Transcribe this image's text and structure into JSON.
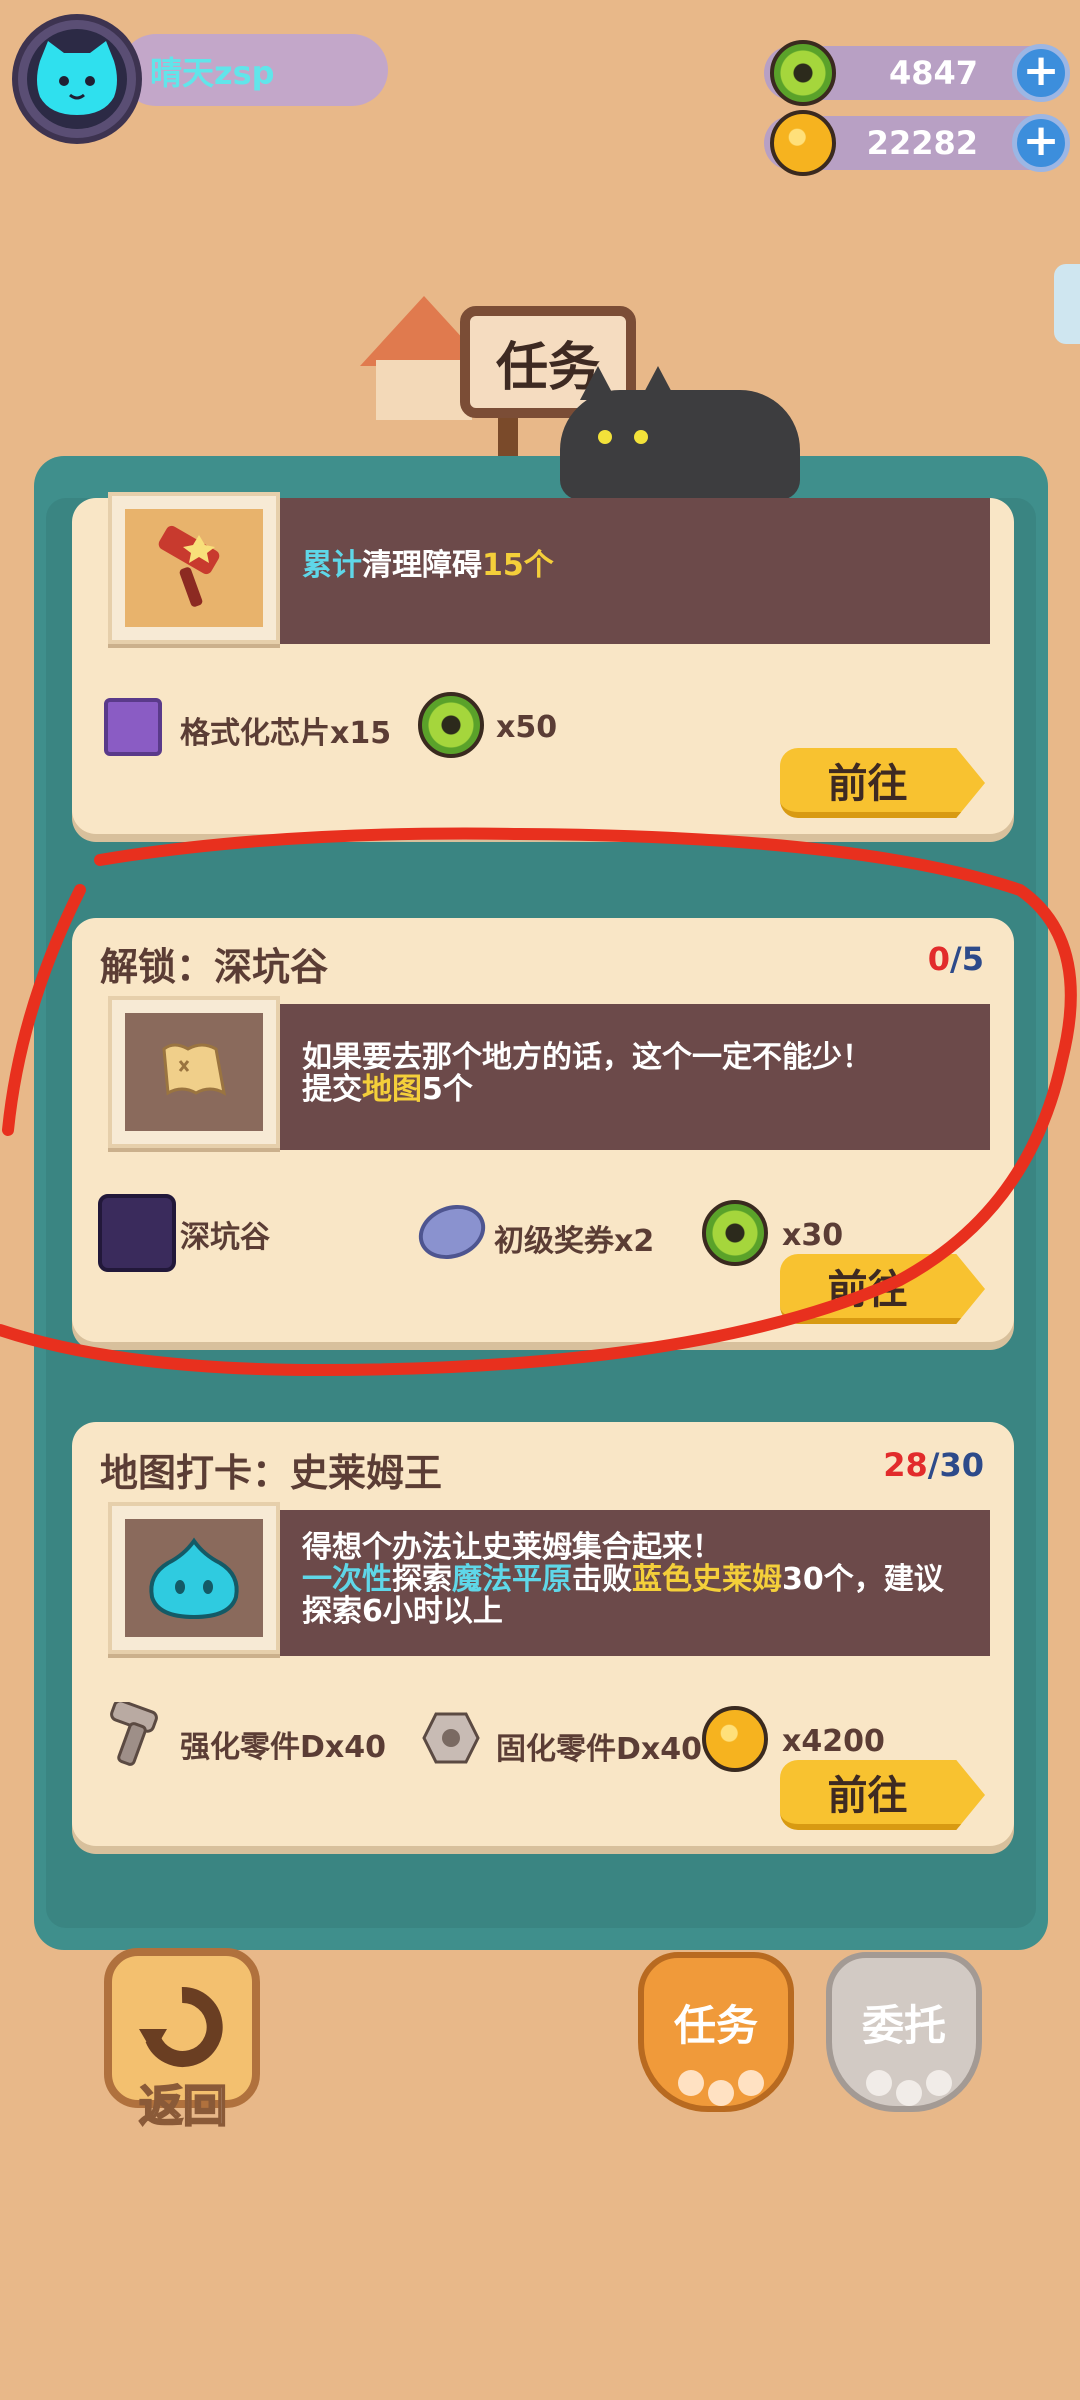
{
  "header": {
    "player_name": "晴天zsp",
    "currency": [
      {
        "icon": "green-gear-coin-icon",
        "value": "4847",
        "plus": "+"
      },
      {
        "icon": "gold-coin-icon",
        "value": "22282",
        "plus": "+"
      }
    ]
  },
  "title": "任务",
  "tasks": [
    {
      "title": "",
      "progress_current": "",
      "progress_sep": "",
      "progress_total": "",
      "image_icon": "roller-brush-icon",
      "desc_line1_parts": [
        "累计",
        "清理障碍",
        "15个"
      ],
      "desc_line2_parts": [],
      "rewards": [
        {
          "icon": "format-chip-icon",
          "label": "格式化芯片x15"
        },
        {
          "icon": "green-gear-coin-icon",
          "label": "x50"
        }
      ],
      "button": "前往"
    },
    {
      "title": "解锁：深坑谷",
      "progress_current": "0",
      "progress_sep": "/",
      "progress_total": "5",
      "image_icon": "map-scroll-icon",
      "desc_line1_parts": [
        "如果要去那个地方的话，这个一定不能少！"
      ],
      "desc_line2_parts": [
        "提交",
        "地图",
        "5个"
      ],
      "rewards": [
        {
          "icon": "deep-valley-icon",
          "label": "深坑谷"
        },
        {
          "icon": "ticket-icon",
          "label": "初级奖券x2"
        },
        {
          "icon": "green-gear-coin-icon",
          "label": "x30"
        }
      ],
      "button": "前往"
    },
    {
      "title": "地图打卡：史莱姆王",
      "progress_current": "28",
      "progress_sep": "/",
      "progress_total": "30",
      "image_icon": "slime-icon",
      "desc_line1_parts": [
        "得想个办法让史莱姆集合起来！"
      ],
      "desc_line2_parts": [
        "一次性",
        "探索",
        "魔法平原",
        "击败",
        "蓝色史莱姆",
        "30个，建议"
      ],
      "desc_line3_parts": [
        "探索6小时以上"
      ],
      "rewards": [
        {
          "icon": "bolt-icon",
          "label": "强化零件Dx40"
        },
        {
          "icon": "nut-icon",
          "label": "固化零件Dx40"
        },
        {
          "icon": "gold-coin-icon",
          "label": "x4200"
        }
      ],
      "button": "前往"
    }
  ],
  "bottom": {
    "back_label": "返回",
    "tab_task": "任务",
    "tab_delegate": "委托"
  },
  "colors": {
    "background": "#e8b889",
    "panel": "#3f8f8c",
    "card": "#f9e6c6",
    "desc_box": "#6c4a4a",
    "button": "#f8c230",
    "annotation": "#e8301e"
  }
}
